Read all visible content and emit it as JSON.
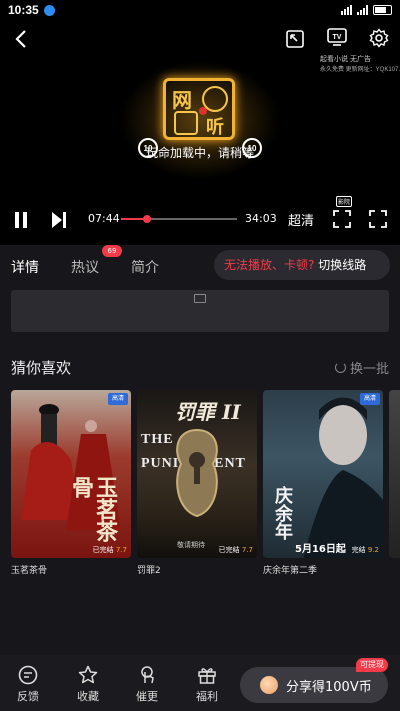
{
  "status_bar": {
    "time": "10:35"
  },
  "player": {
    "loading_text": "玩命加载中，请稍等",
    "skip_back_label": "10",
    "skip_forward_label": "10",
    "ad_line1": "起看小说 无广告",
    "ad_line2": "永久免费 更新网址：YQK107.APP",
    "current_time": "07:44",
    "total_time": "34:03",
    "progress": 0.22,
    "quality_label": "超清",
    "corner_tag": "影院"
  },
  "tabs": {
    "items": [
      {
        "label": "详情",
        "active": true
      },
      {
        "label": "热议",
        "active": false
      },
      {
        "label": "简介",
        "active": false
      }
    ],
    "comment_badge": "69",
    "switch_warning": "无法播放、卡顿?",
    "switch_action": "切换线路"
  },
  "recommend": {
    "title": "猜你喜欢",
    "refresh_label": "换一批",
    "items": [
      {
        "title": "玉茗茶骨",
        "tag": "高清",
        "score_prefix": "已完结",
        "score": "7.7",
        "poster_text": "玉茗茶骨"
      },
      {
        "title": "罚罪2",
        "tag": "",
        "score_prefix": "已完结",
        "score": "7.7",
        "poster_text": "THE PUNISHMENT",
        "poster_sub": "敬请期待",
        "poster_cn": "罚罪 II"
      },
      {
        "title": "庆余年第二季",
        "tag": "高清",
        "score_prefix": "完结",
        "score": "9.2",
        "poster_text": "庆余年",
        "poster_sub": "5月16日起"
      },
      {
        "title": "",
        "tag": "",
        "score_prefix": "",
        "score": ""
      }
    ]
  },
  "bottom_bar": {
    "items": [
      {
        "label": "反馈",
        "icon": "feedback-icon"
      },
      {
        "label": "收藏",
        "icon": "star-icon"
      },
      {
        "label": "催更",
        "icon": "hand-icon"
      },
      {
        "label": "福利",
        "icon": "gift-icon"
      }
    ],
    "share_label": "分享得100V币",
    "withdraw_badge": "可提现"
  },
  "colors": {
    "accent": "#f23a48",
    "background": "#17171b",
    "gold": "#f2b233"
  }
}
